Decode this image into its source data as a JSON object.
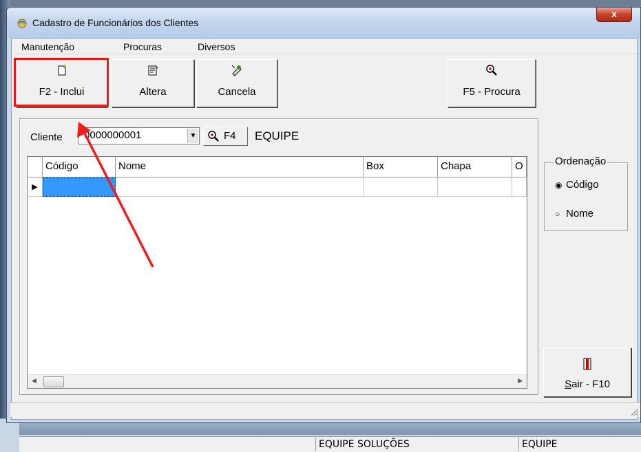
{
  "window": {
    "title": "Cadastro de Funcionários dos Clientes",
    "close_label": "x"
  },
  "menu": {
    "items": [
      "Manutenção",
      "Procuras",
      "Diversos"
    ]
  },
  "toolbar": {
    "inclui": "F2 - Inclui",
    "altera": "Altera",
    "cancela": "Cancela",
    "procura": "F5 - Procura"
  },
  "cliente": {
    "label": "Cliente",
    "value": "0000000001",
    "f4_label": "F4",
    "name": "EQUIPE"
  },
  "grid": {
    "columns": [
      "Código",
      "Nome",
      "Box",
      "Chapa",
      "O"
    ],
    "row_marker": "▶"
  },
  "ordenacao": {
    "legend": "Ordenação",
    "options": [
      "Código",
      "Nome"
    ],
    "selected": "Código"
  },
  "sair": {
    "label_prefix": "S",
    "label_rest": "air - F10"
  },
  "background_app": {
    "status_cells": [
      "EQUIPE SOLUÇÕES",
      "EQUIPE"
    ]
  },
  "colors": {
    "highlight": "#e21a1a",
    "selected_cell": "#3399ff"
  }
}
